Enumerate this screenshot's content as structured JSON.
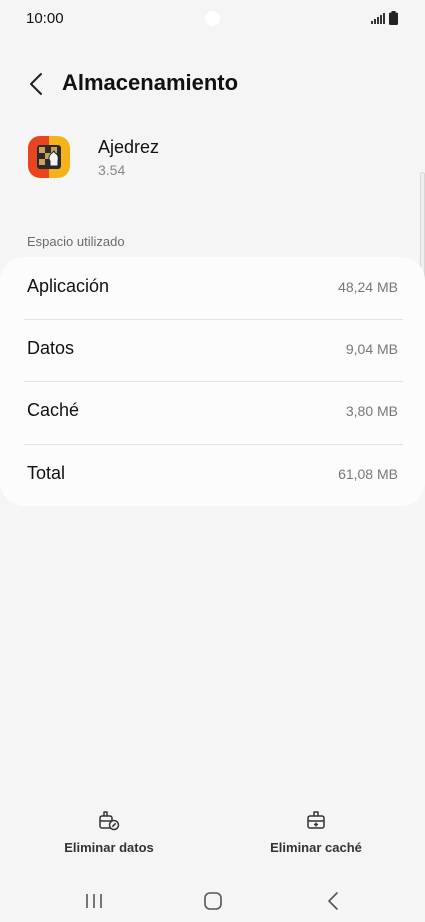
{
  "status_bar": {
    "time": "10:00"
  },
  "header": {
    "title": "Almacenamiento"
  },
  "app": {
    "name": "Ajedrez",
    "version": "3.54"
  },
  "section": {
    "title": "Espacio utilizado"
  },
  "storage": [
    {
      "label": "Aplicación",
      "value": "48,24 MB"
    },
    {
      "label": "Datos",
      "value": "9,04 MB"
    },
    {
      "label": "Caché",
      "value": "3,80 MB"
    },
    {
      "label": "Total",
      "value": "61,08 MB"
    }
  ],
  "actions": {
    "clear_data_label": "Eliminar datos",
    "clear_cache_label": "Eliminar caché"
  },
  "icons": {
    "back": "chevron-left-icon",
    "clear_data": "clear-data-icon",
    "clear_cache": "clear-cache-icon",
    "nav_recents": "recents-icon",
    "nav_home": "home-icon",
    "nav_back": "back-icon"
  }
}
